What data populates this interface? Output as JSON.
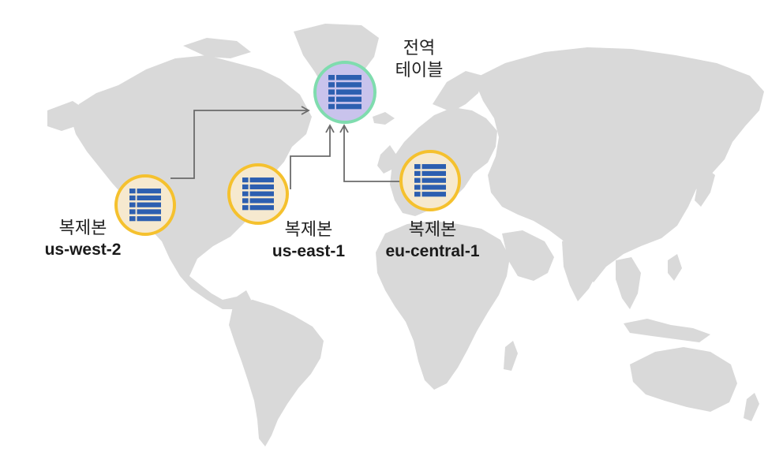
{
  "global_table": {
    "label_line1": "전역",
    "label_line2": "테이블",
    "icon": "table-icon"
  },
  "replicas": [
    {
      "caption": "복제본",
      "region": "us-west-2",
      "icon": "table-icon"
    },
    {
      "caption": "복제본",
      "region": "us-east-1",
      "icon": "table-icon"
    },
    {
      "caption": "복제본",
      "region": "eu-central-1",
      "icon": "table-icon"
    }
  ],
  "colors": {
    "map_land": "#d9d9d9",
    "replica_ring": "#f5c12e",
    "replica_fill": "#f6e9cf",
    "global_ring": "#7fdcae",
    "global_fill": "#c9c3ec",
    "table_icon": "#2d5fb0",
    "connector": "#6b6b6b"
  }
}
